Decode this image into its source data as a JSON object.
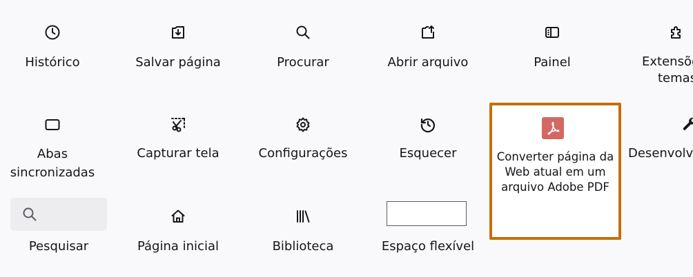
{
  "row1": [
    {
      "name": "historico",
      "icon": "clock-icon",
      "label": "Histórico"
    },
    {
      "name": "salvar-pagina",
      "icon": "save-page-icon",
      "label": "Salvar página"
    },
    {
      "name": "procurar",
      "icon": "search-icon",
      "label": "Procurar"
    },
    {
      "name": "abrir-arquivo",
      "icon": "open-file-icon",
      "label": "Abrir arquivo"
    },
    {
      "name": "painel",
      "icon": "sidebar-icon",
      "label": "Painel"
    },
    {
      "name": "extensoes-temas",
      "icon": "puzzle-icon",
      "label_line1": "Extensõe",
      "label_line2": "temas"
    }
  ],
  "row2": [
    {
      "name": "abas-sincronizadas",
      "icon": "synced-tabs-icon",
      "label_line1": "Abas",
      "label_line2": "sincronizadas"
    },
    {
      "name": "capturar-tela",
      "icon": "screenshot-icon",
      "label": "Capturar tela"
    },
    {
      "name": "configuracoes",
      "icon": "gear-icon",
      "label": "Configurações"
    },
    {
      "name": "esquecer",
      "icon": "history-reset-icon",
      "label": "Esquecer"
    },
    {
      "name": "converter-pdf",
      "icon": "adobe-pdf-icon",
      "label_line1": "Converter página da",
      "label_line2": "Web atual em um",
      "label_line3": "arquivo Adobe PDF"
    },
    {
      "name": "desenvolvimento",
      "icon": "wrench-icon",
      "label": "Desenvolvi"
    }
  ],
  "row3": [
    {
      "name": "pesquisar",
      "icon": "search-icon",
      "label": "Pesquisar"
    },
    {
      "name": "pagina-inicial",
      "icon": "home-icon",
      "label": "Página inicial"
    },
    {
      "name": "biblioteca",
      "icon": "library-icon",
      "label": "Biblioteca"
    },
    {
      "name": "espaco-flexivel",
      "label": "Espaço flexível"
    }
  ],
  "colors": {
    "highlight_border": "#c46f08",
    "pdf_icon_bg": "#d36962",
    "background": "#f9f9fb",
    "text": "#15141a"
  }
}
